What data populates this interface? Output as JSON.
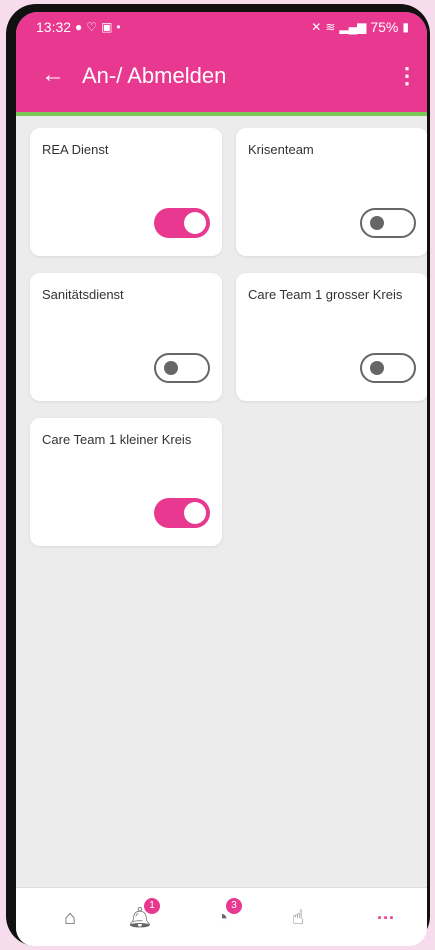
{
  "status": {
    "time": "13:32",
    "battery": "75%"
  },
  "appbar": {
    "title": "An-/ Abmelden"
  },
  "cards": [
    {
      "label": "REA Dienst",
      "on": true
    },
    {
      "label": "Krisenteam",
      "on": false
    },
    {
      "label": "Sanitätsdienst",
      "on": false
    },
    {
      "label": "Care Team 1 grosser Kreis",
      "on": false
    },
    {
      "label": "Care Team 1 kleiner Kreis",
      "on": true
    }
  ],
  "nav": {
    "notifications_badge": "1",
    "alerts_badge": "3",
    "more_label": "···"
  },
  "colors": {
    "accent": "#e8388f",
    "divider": "#7cc85a"
  }
}
